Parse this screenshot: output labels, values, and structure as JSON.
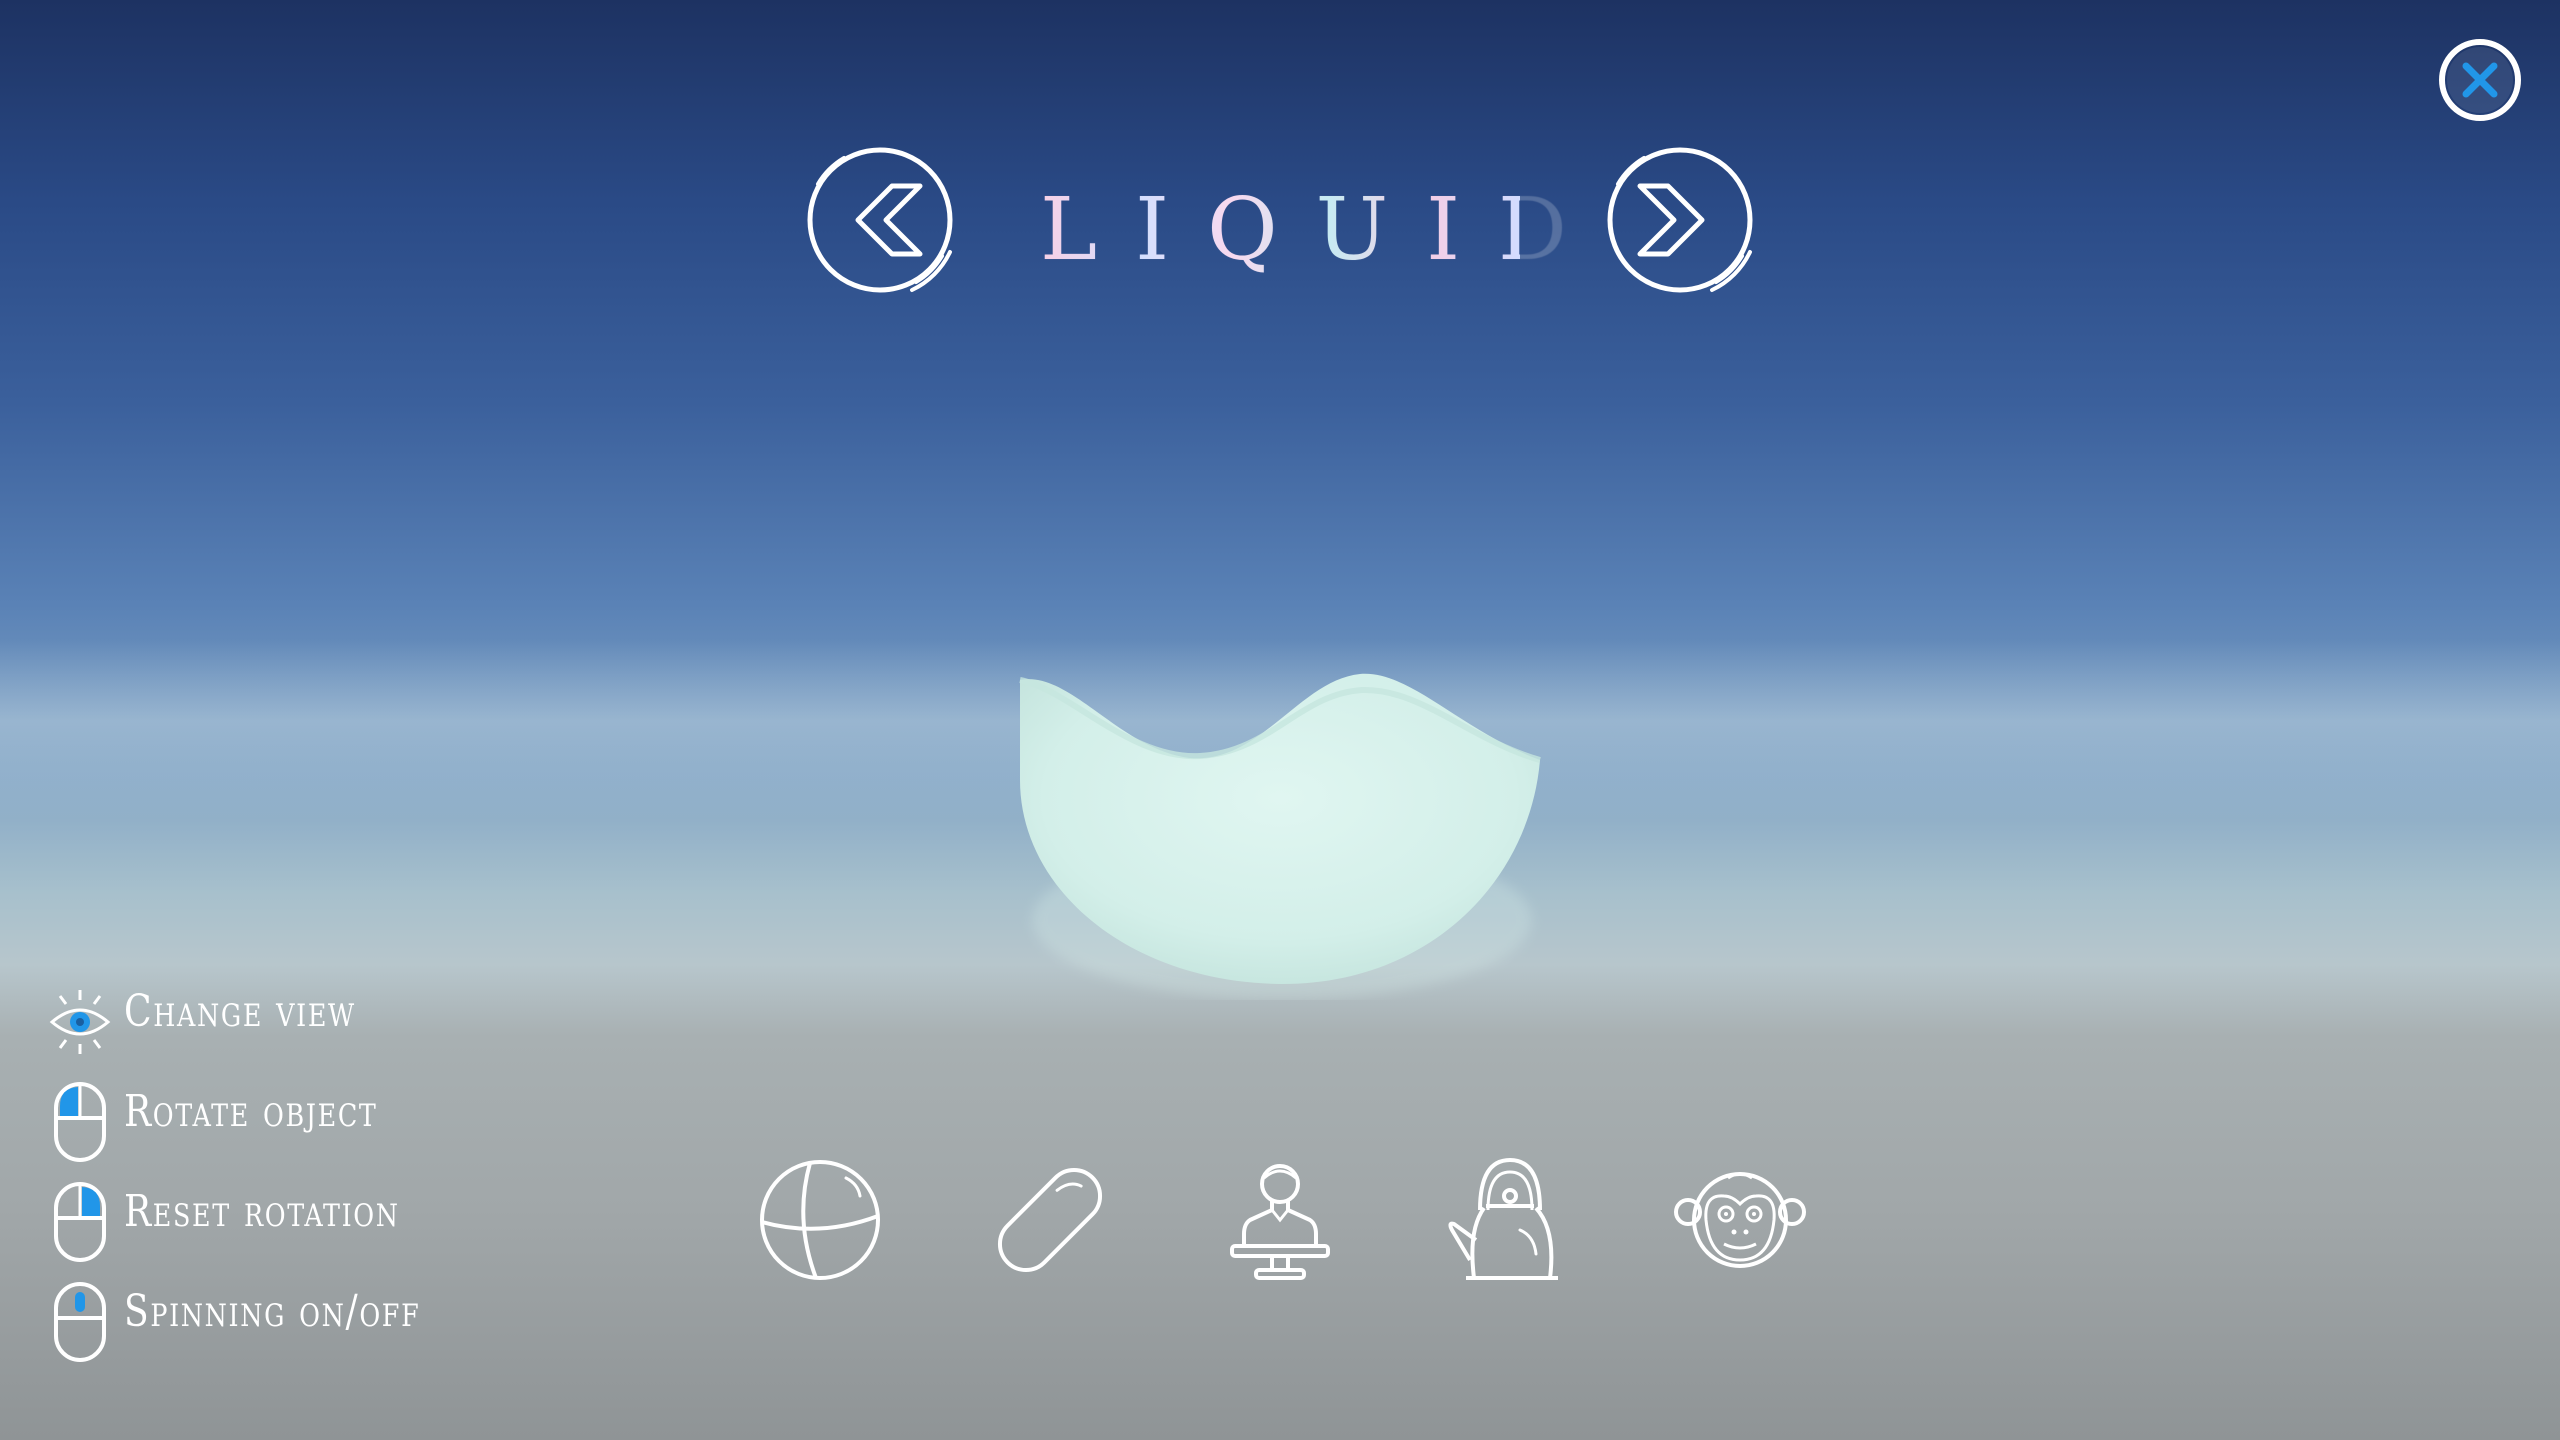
{
  "title": "LIQUID",
  "nav": {
    "prev_icon": "chevron-left-circle-icon",
    "next_icon": "chevron-right-circle-icon",
    "close_icon": "close-circle-icon"
  },
  "controls": [
    {
      "icon": "eye-icon",
      "label": "Change view"
    },
    {
      "icon": "mouse-left-click-icon",
      "label": "Rotate object"
    },
    {
      "icon": "mouse-right-click-icon",
      "label": "Reset rotation"
    },
    {
      "icon": "mouse-scroll-wheel-icon",
      "label": "Spinning on/off"
    }
  ],
  "shapes": [
    {
      "icon": "sphere-icon"
    },
    {
      "icon": "capsule-icon"
    },
    {
      "icon": "bust-icon"
    },
    {
      "icon": "teapot-icon"
    },
    {
      "icon": "monkey-icon"
    }
  ],
  "colors": {
    "accent": "#2196e8",
    "liquid": "#d7f1ec",
    "sky_top": "#1d3262",
    "ground": "#a1a7a9"
  }
}
